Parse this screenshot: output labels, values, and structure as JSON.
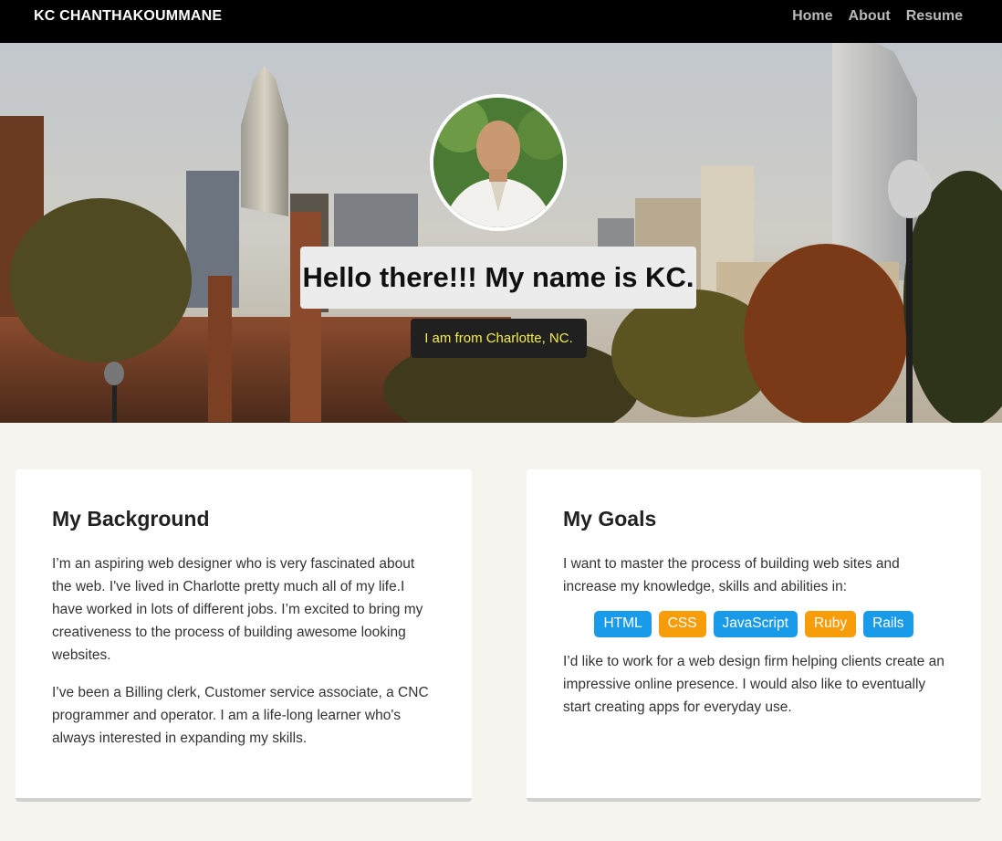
{
  "navbar": {
    "brand": "KC CHANTHAKOUMMANE",
    "links": [
      {
        "label": "Home"
      },
      {
        "label": "About"
      },
      {
        "label": "Resume"
      }
    ]
  },
  "hero": {
    "title": "Hello there!!! My name is KC.",
    "subtitle": "I am from Charlotte, NC."
  },
  "background_card": {
    "title": "My Background",
    "paragraphs": [
      "I’m an aspiring web designer who is very fascinated about the web. I've lived in Charlotte pretty much all of my life.I have worked in lots of different jobs. I’m excited to bring my creativeness to the process of building awesome looking websites.",
      "I’ve been a Billing clerk, Customer service associate, a CNC programmer and operator. I am a life-long learner who's always interested in expanding my skills."
    ]
  },
  "goals_card": {
    "title": "My Goals",
    "intro": "I want to master the process of building web sites and increase my knowledge, skills and abilities in:",
    "tags": [
      {
        "label": "HTML",
        "color": "#1a9bea"
      },
      {
        "label": "CSS",
        "color": "#f79d0a"
      },
      {
        "label": "JavaScript",
        "color": "#1a9bea"
      },
      {
        "label": "Ruby",
        "color": "#f79d0a"
      },
      {
        "label": "Rails",
        "color": "#1a9bea"
      }
    ],
    "outro": "I’d like to work for a web design firm helping clients create an impressive online presence. I would also like to eventually start creating apps for everyday use."
  },
  "colors": {
    "navbar_bg": "#000000",
    "page_bg": "#f5f4ef",
    "subtitle_text": "#f6ee4a"
  }
}
